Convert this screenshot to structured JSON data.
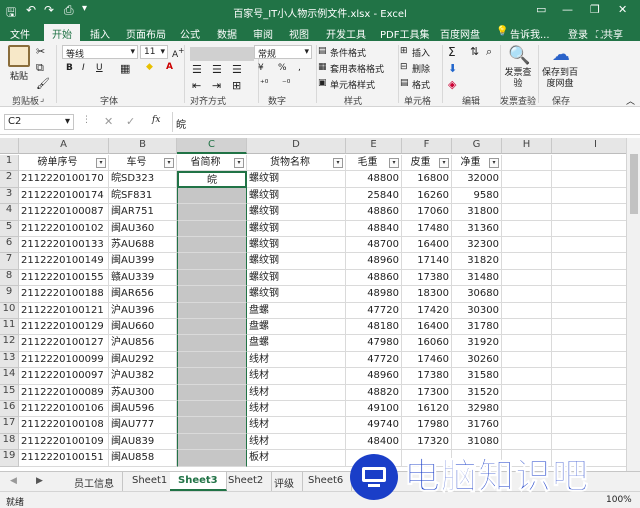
{
  "window": {
    "title": "百家号_IT小人物示例文件.xlsx - Excel",
    "login": "登录",
    "share": "共享"
  },
  "ribbon": {
    "tabs": [
      "文件",
      "开始",
      "插入",
      "页面布局",
      "公式",
      "数据",
      "审阅",
      "视图",
      "开发工具",
      "PDF工具集",
      "百度网盘"
    ],
    "active_tab": "开始",
    "tell_me": "告诉我...",
    "paste": "粘贴",
    "font_name": "等线",
    "font_size": "11",
    "number_format": "常规",
    "bold": "B",
    "italic": "I",
    "underline": "U",
    "percent": "%",
    "thousands": ",",
    "conditional_format": "条件格式",
    "table_format": "套用表格格式",
    "cell_styles": "单元格样式",
    "insert": "插入",
    "delete": "删除",
    "format": "格式",
    "publish_check": "发票查验",
    "save_baidu": "保存到百度网盘",
    "groups": {
      "clipboard": "剪贴板",
      "font": "字体",
      "alignment": "对齐方式",
      "number": "数字",
      "styles": "样式",
      "cells": "单元格",
      "editing": "编辑",
      "invoice": "发票查验",
      "save": "保存"
    }
  },
  "formula_bar": {
    "name_box": "C2",
    "fx": "fx",
    "value": "皖"
  },
  "sheet": {
    "columns": [
      "A",
      "B",
      "C",
      "D",
      "E",
      "F",
      "G",
      "H",
      "I"
    ],
    "selected_column": "C",
    "headers": [
      "磅单序号",
      "车号",
      "省简称",
      "货物名称",
      "毛重",
      "皮重",
      "净重"
    ],
    "row_numbers": [
      "1",
      "2",
      "3",
      "4",
      "5",
      "6",
      "7",
      "8",
      "9",
      "10",
      "11",
      "12",
      "13",
      "14",
      "15",
      "16",
      "17",
      "18",
      "19"
    ],
    "rows": [
      [
        "2112220100170",
        "皖SD323",
        "皖",
        "螺纹钢",
        "48800",
        "16800",
        "32000"
      ],
      [
        "2112220100174",
        "皖SF831",
        "",
        "螺纹钢",
        "25840",
        "16260",
        "9580"
      ],
      [
        "2112220100087",
        "闽AR751",
        "",
        "螺纹钢",
        "48860",
        "17060",
        "31800"
      ],
      [
        "2112220100102",
        "闽AU360",
        "",
        "螺纹钢",
        "48840",
        "17480",
        "31360"
      ],
      [
        "2112220100133",
        "苏AU688",
        "",
        "螺纹钢",
        "48700",
        "16400",
        "32300"
      ],
      [
        "2112220100149",
        "闽AU399",
        "",
        "螺纹钢",
        "48960",
        "17140",
        "31820"
      ],
      [
        "2112220100155",
        "赣AU339",
        "",
        "螺纹钢",
        "48860",
        "17380",
        "31480"
      ],
      [
        "2112220100188",
        "闽AR656",
        "",
        "螺纹钢",
        "48980",
        "18300",
        "30680"
      ],
      [
        "2112220100121",
        "沪AU396",
        "",
        "盘螺",
        "47720",
        "17420",
        "30300"
      ],
      [
        "2112220100129",
        "闽AU660",
        "",
        "盘螺",
        "48180",
        "16400",
        "31780"
      ],
      [
        "2112220100127",
        "沪AU856",
        "",
        "盘螺",
        "47980",
        "16060",
        "31920"
      ],
      [
        "2112220100099",
        "闽AU292",
        "",
        "线材",
        "47720",
        "17460",
        "30260"
      ],
      [
        "2112220100097",
        "沪AU382",
        "",
        "线材",
        "48960",
        "17380",
        "31580"
      ],
      [
        "2112220100089",
        "苏AU300",
        "",
        "线材",
        "48820",
        "17300",
        "31520"
      ],
      [
        "2112220100106",
        "闽AU596",
        "",
        "线材",
        "49100",
        "16120",
        "32980"
      ],
      [
        "2112220100108",
        "闽AU777",
        "",
        "线材",
        "49740",
        "17980",
        "31760"
      ],
      [
        "2112220100109",
        "闽AU839",
        "",
        "线材",
        "48400",
        "17320",
        "31080"
      ],
      [
        "2112220100151",
        "闽AU858",
        "",
        "板材",
        "",
        "",
        ""
      ]
    ]
  },
  "sheet_tabs": [
    "员工信息",
    "Sheet1",
    "Sheet3",
    "Sheet2",
    "评级",
    "Sheet6"
  ],
  "active_sheet": "Sheet3",
  "status": {
    "ready": "就绪",
    "zoom": "100%"
  },
  "watermark": {
    "text": "电脑知识吧",
    "color": "#1a3ec8"
  }
}
